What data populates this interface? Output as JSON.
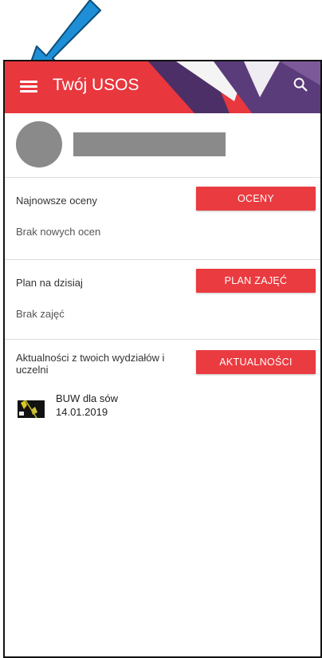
{
  "appbar": {
    "title": "Twój USOS",
    "menu_icon": "hamburger-menu-icon",
    "search_icon": "search-icon",
    "color": "#e8373d"
  },
  "profile": {
    "avatar": "avatar-placeholder",
    "name_redacted": true
  },
  "sections": [
    {
      "label": "Najnowsze oceny",
      "button": "OCENY",
      "empty_text": "Brak nowych ocen"
    },
    {
      "label": "Plan na dzisiaj",
      "button": "PLAN ZAJĘĆ",
      "empty_text": "Brak zajęć"
    },
    {
      "label": "Aktualności z twoich wydziałów i uczelni",
      "button": "AKTUALNOŚCI",
      "news": [
        {
          "title": "BUW dla sów",
          "date": "14.01.2019"
        }
      ]
    }
  ],
  "annotation": {
    "arrow_color": "#1e8fd6",
    "points_to": "hamburger-menu-icon"
  }
}
